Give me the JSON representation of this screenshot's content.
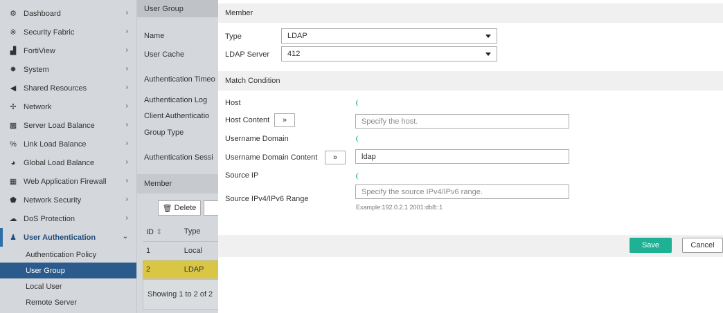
{
  "sidebar": {
    "items": [
      {
        "label": "Dashboard",
        "icon": "dashboard-icon",
        "glyph": "⚙"
      },
      {
        "label": "Security Fabric",
        "icon": "security-fabric-icon",
        "glyph": "※"
      },
      {
        "label": "FortiView",
        "icon": "fortiview-icon",
        "glyph": "▟"
      },
      {
        "label": "System",
        "icon": "gear-icon",
        "glyph": "✸"
      },
      {
        "label": "Shared Resources",
        "icon": "share-icon",
        "glyph": "◀"
      },
      {
        "label": "Network",
        "icon": "network-icon",
        "glyph": "✢"
      },
      {
        "label": "Server Load Balance",
        "icon": "server-icon",
        "glyph": "▩"
      },
      {
        "label": "Link Load Balance",
        "icon": "link-icon",
        "glyph": "%"
      },
      {
        "label": "Global Load Balance",
        "icon": "globe-icon",
        "glyph": "◕"
      },
      {
        "label": "Web Application Firewall",
        "icon": "firewall-icon",
        "glyph": "▦"
      },
      {
        "label": "Network Security",
        "icon": "shield-icon",
        "glyph": "⬟"
      },
      {
        "label": "DoS Protection",
        "icon": "cloud-icon",
        "glyph": "☁"
      },
      {
        "label": "User Authentication",
        "icon": "user-icon",
        "glyph": "♟"
      }
    ],
    "sub_items": [
      {
        "label": "Authentication Policy"
      },
      {
        "label": "User Group"
      },
      {
        "label": "Local User"
      },
      {
        "label": "Remote Server"
      }
    ]
  },
  "middle": {
    "header": "User Group",
    "fields": [
      "Name",
      "User Cache",
      "Authentication Timeo",
      "Authentication Log",
      "Client Authenticatio",
      "Group Type",
      "Authentication Sessi"
    ],
    "member_header": "Member",
    "delete_label": "Delete",
    "table_headers": [
      "ID",
      "Type"
    ],
    "rows": [
      [
        "1",
        "Local"
      ],
      [
        "2",
        "LDAP"
      ]
    ],
    "showing": "Showing 1 to 2 of 2"
  },
  "form": {
    "member_title": "Member",
    "type_label": "Type",
    "type_value": "LDAP",
    "ldap_server_label": "LDAP Server",
    "ldap_server_value": "412",
    "match_title": "Match Condition",
    "host_label": "Host",
    "host_content_label": "Host Content",
    "host_placeholder": "Specify the host.",
    "username_domain_label": "Username Domain",
    "username_domain_content_label": "Username Domain Content",
    "username_domain_value": "ldap",
    "source_ip_label": "Source IP",
    "source_range_label": "Source IPv4/IPv6 Range",
    "source_range_placeholder": "Specify the source IPv4/IPv6 range.",
    "source_range_hint": "Example:192.0.2.1 2001:db8::1",
    "expand_glyph": "»",
    "save_label": "Save",
    "cancel_label": "Cancel"
  },
  "colors": {
    "accent": "#1fb193",
    "sidebar_bg": "#d4d7db",
    "active_nav": "#2a5b8c",
    "row_highlight": "#d9c645"
  }
}
